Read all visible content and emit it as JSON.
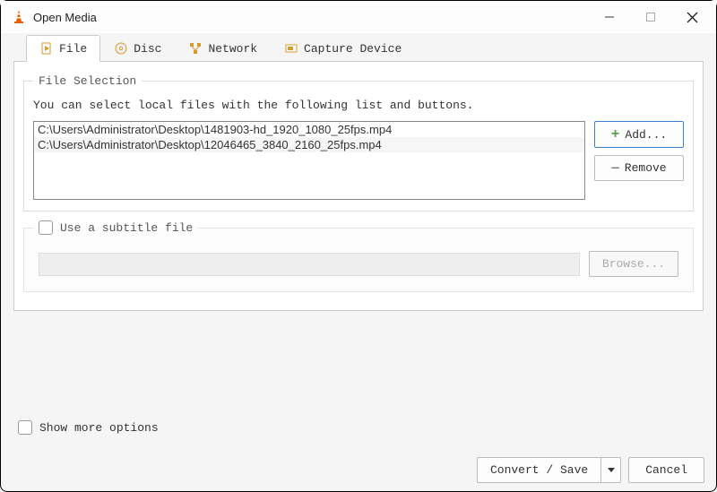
{
  "window": {
    "title": "Open Media"
  },
  "tabs": {
    "file": "File",
    "disc": "Disc",
    "network": "Network",
    "capture": "Capture Device"
  },
  "fileSelection": {
    "legend": "File Selection",
    "description": "You can select local files with the following list and buttons.",
    "files": [
      "C:\\Users\\Administrator\\Desktop\\1481903-hd_1920_1080_25fps.mp4",
      "C:\\Users\\Administrator\\Desktop\\12046465_3840_2160_25fps.mp4"
    ],
    "addLabel": "Add...",
    "removeLabel": "Remove"
  },
  "subtitle": {
    "label": "Use a subtitle file",
    "browseLabel": "Browse..."
  },
  "options": {
    "showMoreLabel": "Show more options"
  },
  "footer": {
    "convertLabel": "Convert / Save",
    "cancelLabel": "Cancel"
  }
}
